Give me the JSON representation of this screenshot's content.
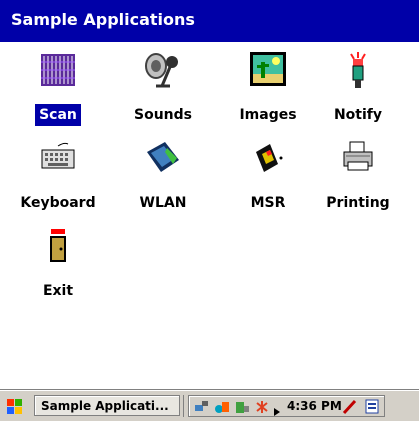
{
  "window": {
    "title": "Sample Applications"
  },
  "apps": [
    {
      "id": "scan",
      "label": "Scan",
      "icon": "scan-icon",
      "selected": true
    },
    {
      "id": "sounds",
      "label": "Sounds",
      "icon": "sounds-icon",
      "selected": false
    },
    {
      "id": "images",
      "label": "Images",
      "icon": "images-icon",
      "selected": false
    },
    {
      "id": "notify",
      "label": "Notify",
      "icon": "notify-icon",
      "selected": false
    },
    {
      "id": "keyboard",
      "label": "Keyboard",
      "icon": "keyboard-icon",
      "selected": false
    },
    {
      "id": "wlan",
      "label": "WLAN",
      "icon": "wlan-icon",
      "selected": false
    },
    {
      "id": "msr",
      "label": "MSR",
      "icon": "msr-icon",
      "selected": false
    },
    {
      "id": "printing",
      "label": "Printing",
      "icon": "printer-icon",
      "selected": false
    },
    {
      "id": "exit",
      "label": "Exit",
      "icon": "exit-door-icon",
      "selected": false
    }
  ],
  "taskbar": {
    "task_label": "Sample Applicati...",
    "clock": "4:36 PM",
    "tray_icons": [
      "network-icon",
      "sync-icon",
      "battery-icon",
      "bluetooth-icon",
      "expand-arrow-icon",
      "pen-input-icon",
      "sip-keyboard-icon"
    ]
  },
  "colors": {
    "titlebar": "#0000a8",
    "selection": "#0000a8",
    "taskbar": "#d4d0c8"
  }
}
